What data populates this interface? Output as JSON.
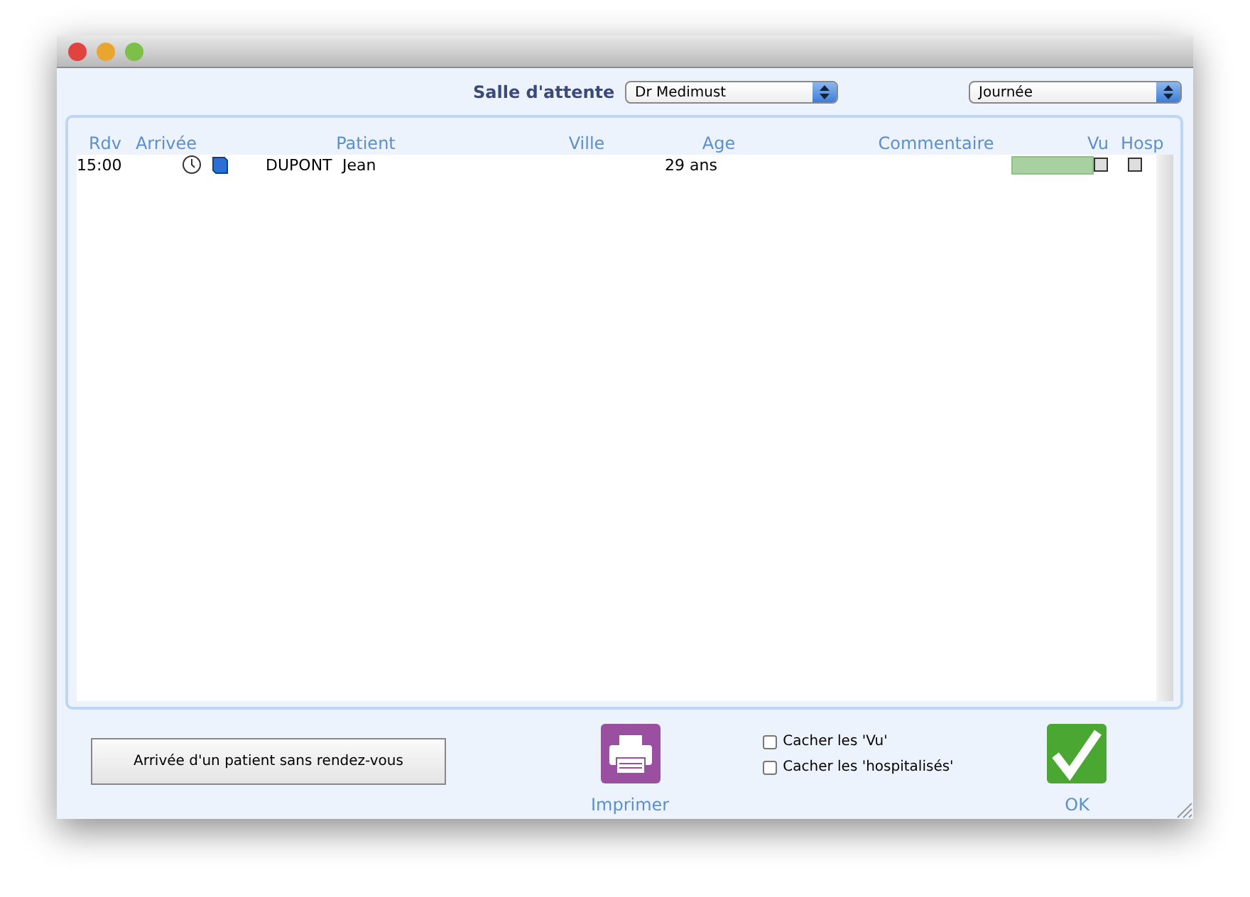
{
  "toolbar": {
    "label": "Salle d'attente",
    "doctor_select": {
      "value": "Dr Medimust"
    },
    "period_select": {
      "value": "Journée"
    }
  },
  "table": {
    "columns": [
      "Rdv",
      "Arrivée",
      "Patient",
      "Ville",
      "Age",
      "Commentaire",
      "Vu",
      "Hosp"
    ],
    "rows": [
      {
        "rdv": "15:00",
        "last_name": "DUPONT",
        "first_name": "Jean",
        "age": "29 ans",
        "color": "#a8d0a0",
        "vu": false,
        "hosp": false
      }
    ]
  },
  "walk_in_button": "Arrivée d'un patient sans rendez-vous",
  "print_button": "Imprimer",
  "options": [
    {
      "label": "Cacher les 'Vu'",
      "checked": false
    },
    {
      "label": "Cacher les 'hospitalisés'",
      "checked": false
    }
  ],
  "ok_button": "OK"
}
